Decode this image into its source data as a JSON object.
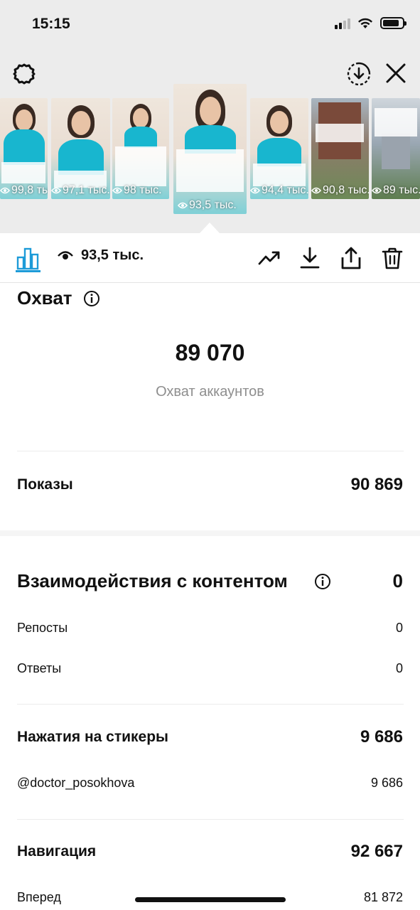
{
  "status_bar": {
    "time": "15:15"
  },
  "header": {
    "settings_icon": "gear-icon",
    "download_icon": "download-circle-icon",
    "close_icon": "close-icon"
  },
  "story_thumbnails": [
    {
      "views": "99,8 тыс."
    },
    {
      "views": "97,1 тыс."
    },
    {
      "views": "98 тыс."
    },
    {
      "views": "93,5 тыс.",
      "active": true
    },
    {
      "views": "94,4 тыс."
    },
    {
      "views": "90,8 тыс."
    },
    {
      "views": "89 тыс."
    }
  ],
  "toolbar": {
    "insights_icon": "bar-chart-icon",
    "viewers_icon": "eye-icon",
    "viewers_count": "93,5 тыс.",
    "promote_icon": "trending-up-icon",
    "save_icon": "download-icon",
    "share_icon": "share-icon",
    "delete_icon": "trash-icon",
    "accent_color": "#1d9bd8"
  },
  "reach": {
    "title": "Охват",
    "value": "89 070",
    "caption": "Охват аккаунтов"
  },
  "impressions": {
    "label": "Показы",
    "value": "90 869"
  },
  "interactions": {
    "title": "Взаимодействия с контентом",
    "value": "0",
    "rows": [
      {
        "label": "Репосты",
        "value": "0"
      },
      {
        "label": "Ответы",
        "value": "0"
      }
    ]
  },
  "sticker_taps": {
    "title": "Нажатия на стикеры",
    "value": "9 686",
    "rows": [
      {
        "label": "@doctor_posokhova",
        "value": "9 686"
      }
    ]
  },
  "navigation": {
    "title": "Навигация",
    "value": "92 667",
    "rows": [
      {
        "label": "Вперед",
        "value": "81 872"
      }
    ]
  }
}
